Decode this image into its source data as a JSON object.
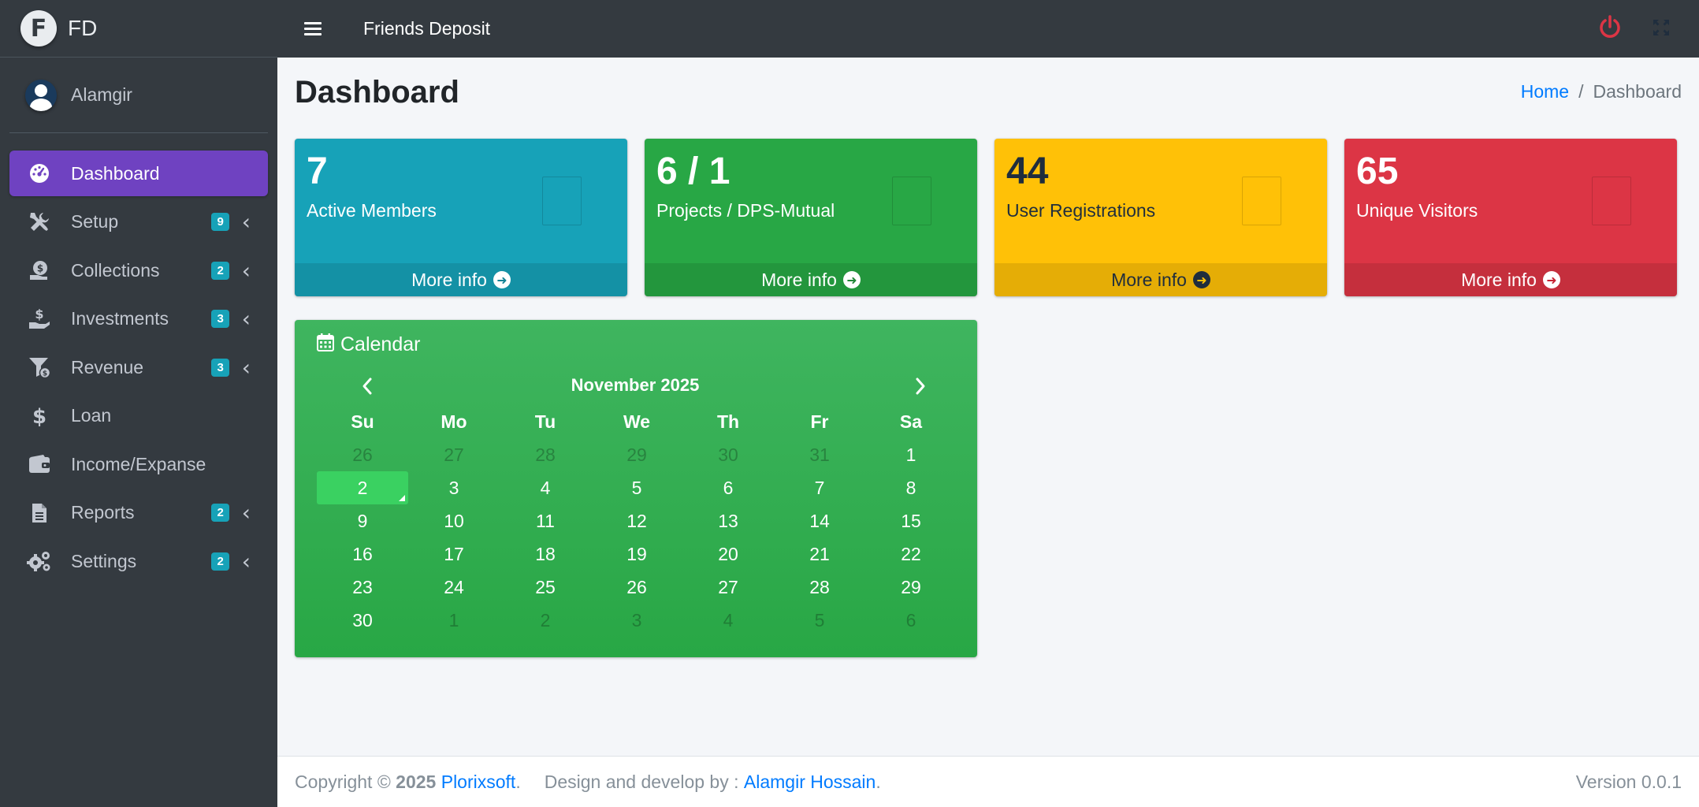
{
  "brand": {
    "logo_letter": "F",
    "name": "FD"
  },
  "user": {
    "name": "Alamgir"
  },
  "sidebar": {
    "items": [
      {
        "label": "Dashboard",
        "icon": "tachometer-icon",
        "badge": "",
        "active": true
      },
      {
        "label": "Setup",
        "icon": "tools-icon",
        "badge": "9"
      },
      {
        "label": "Collections",
        "icon": "money-bag-icon",
        "badge": "2"
      },
      {
        "label": "Investments",
        "icon": "hand-holding-dollar-icon",
        "badge": "3"
      },
      {
        "label": "Revenue",
        "icon": "funnel-dollar-icon",
        "badge": "3"
      },
      {
        "label": "Loan",
        "icon": "dollar-icon",
        "badge": ""
      },
      {
        "label": "Income/Expanse",
        "icon": "wallet-icon",
        "badge": ""
      },
      {
        "label": "Reports",
        "icon": "file-icon",
        "badge": "2"
      },
      {
        "label": "Settings",
        "icon": "cogs-icon",
        "badge": "2"
      }
    ]
  },
  "topbar": {
    "title": "Friends Deposit",
    "power_color": "#dc3545"
  },
  "page": {
    "title": "Dashboard",
    "breadcrumb": {
      "home": "Home",
      "sep": "/",
      "current": "Dashboard"
    }
  },
  "stats": [
    {
      "value": "7",
      "label": "Active Members",
      "more": "More info",
      "color": "#17a2b8"
    },
    {
      "value": "6 / 1",
      "label": "Projects / DPS-Mutual",
      "more": "More info",
      "color": "#28a745"
    },
    {
      "value": "44",
      "label": "User Registrations",
      "more": "More info",
      "color": "#ffc107"
    },
    {
      "value": "65",
      "label": "Unique Visitors",
      "more": "More info",
      "color": "#dc3545"
    }
  ],
  "calendar": {
    "title": "Calendar",
    "month": "November 2025",
    "weekdays": [
      "Su",
      "Mo",
      "Tu",
      "We",
      "Th",
      "Fr",
      "Sa"
    ],
    "weeks": [
      [
        {
          "d": "26",
          "m": true
        },
        {
          "d": "27",
          "m": true
        },
        {
          "d": "28",
          "m": true
        },
        {
          "d": "29",
          "m": true
        },
        {
          "d": "30",
          "m": true
        },
        {
          "d": "31",
          "m": true
        },
        {
          "d": "1"
        }
      ],
      [
        {
          "d": "2",
          "today": true
        },
        {
          "d": "3"
        },
        {
          "d": "4"
        },
        {
          "d": "5"
        },
        {
          "d": "6"
        },
        {
          "d": "7"
        },
        {
          "d": "8"
        }
      ],
      [
        {
          "d": "9"
        },
        {
          "d": "10"
        },
        {
          "d": "11"
        },
        {
          "d": "12"
        },
        {
          "d": "13"
        },
        {
          "d": "14"
        },
        {
          "d": "15"
        }
      ],
      [
        {
          "d": "16"
        },
        {
          "d": "17"
        },
        {
          "d": "18"
        },
        {
          "d": "19"
        },
        {
          "d": "20"
        },
        {
          "d": "21"
        },
        {
          "d": "22"
        }
      ],
      [
        {
          "d": "23"
        },
        {
          "d": "24"
        },
        {
          "d": "25"
        },
        {
          "d": "26"
        },
        {
          "d": "27"
        },
        {
          "d": "28"
        },
        {
          "d": "29"
        }
      ],
      [
        {
          "d": "30"
        },
        {
          "d": "1",
          "m": true
        },
        {
          "d": "2",
          "m": true
        },
        {
          "d": "3",
          "m": true
        },
        {
          "d": "4",
          "m": true
        },
        {
          "d": "5",
          "m": true
        },
        {
          "d": "6",
          "m": true
        }
      ]
    ]
  },
  "footer": {
    "copyright_prefix": "Copyright ©",
    "year": "2025",
    "company": "Plorixsoft",
    "dot": ".",
    "design_prefix": "Design and develop by :",
    "developer": "Alamgir Hossain",
    "dot2": ".",
    "version": "Version 0.0.1"
  }
}
